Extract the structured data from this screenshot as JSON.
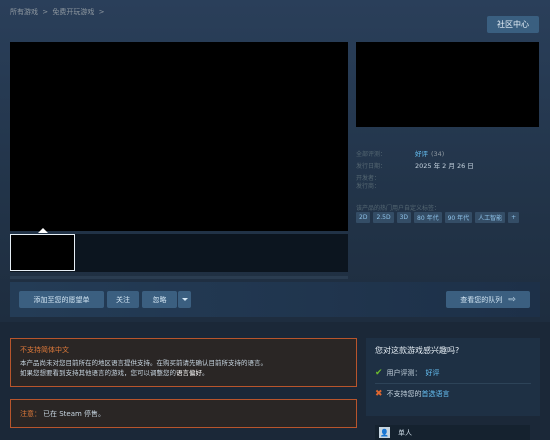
{
  "breadcrumb": [
    "所有游戏",
    ">",
    "免费开玩游戏",
    ">"
  ],
  "community_button": "社区中心",
  "info": {
    "review_label": "全部评测：",
    "review_value": "好评",
    "review_count": "(34)",
    "release_label": "发行日期：",
    "release_value": "2025 年 2 月 26 日",
    "developer_label": "开发者：",
    "publisher_label": "发行商："
  },
  "tags_label": "该产品的热门用户自定义标签：",
  "tags": [
    "2D",
    "2.5D",
    "3D",
    "80 年代",
    "90 年代",
    "人工智能",
    "+"
  ],
  "actions": {
    "wishlist": "添加至您的愿望单",
    "follow": "关注",
    "ignore": "忽略",
    "queue": "查看您的队列"
  },
  "warning": {
    "title": "不支持简体中文",
    "line1": "本产品尚未对您目前所在的地区语言提供支持。在购买前请先确认目前所支持的语言。",
    "line2_prefix": "如果您想要看到支持其他语言的游戏，您可以调整您的",
    "line2_link": "语言偏好",
    "line2_suffix": "。"
  },
  "note": {
    "label": "注意：",
    "text": "已在 Steam 停售。"
  },
  "interest": {
    "title": "您对这款游戏感兴趣吗?",
    "review_label": "用户评测：",
    "review_value": "好评",
    "language_prefix": "不支持您的",
    "language_link": "首选语言"
  },
  "feature": {
    "icon": "person-icon",
    "label": "单人"
  },
  "colors": {
    "background": "#1b2838",
    "accent_blue": "#66c0f4",
    "warning_orange": "#e07a3a",
    "ok_green": "#6cba2e"
  }
}
